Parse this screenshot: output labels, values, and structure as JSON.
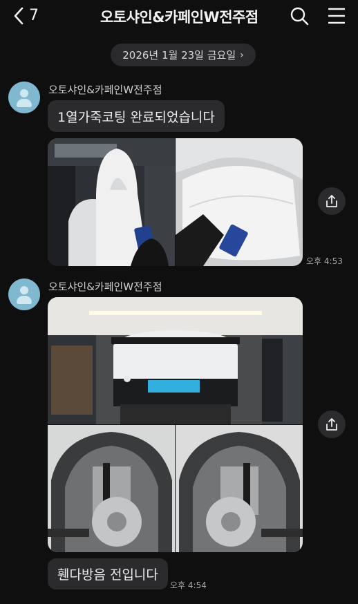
{
  "header": {
    "back_count": "7",
    "title": "오토샤인&카페인W전주점",
    "icons": [
      "chevron-left-icon",
      "search-icon",
      "menu-icon"
    ]
  },
  "date_divider": {
    "label": "2026년 1월 23일 금요일",
    "chevron": "›"
  },
  "messages": [
    {
      "sender": "오토샤인&카페인W전주점",
      "text": "1열가죽코팅 완료되었습니다",
      "photos": [
        "white-leather-seat-photo",
        "white-seat-detail-photo"
      ],
      "time": "오후 4:53"
    },
    {
      "sender": "오토샤인&카페인W전주점",
      "photos": [
        "car-rear-on-lift-photo",
        "left-wheel-well-photo",
        "right-wheel-well-photo"
      ],
      "text": "휀다방음 전입니다",
      "time": "오후 4:54"
    }
  ],
  "colors": {
    "background": "#0f0f10",
    "bubble": "#2b2b2e",
    "avatar": "#7fb8cf",
    "text": "#ececee"
  }
}
